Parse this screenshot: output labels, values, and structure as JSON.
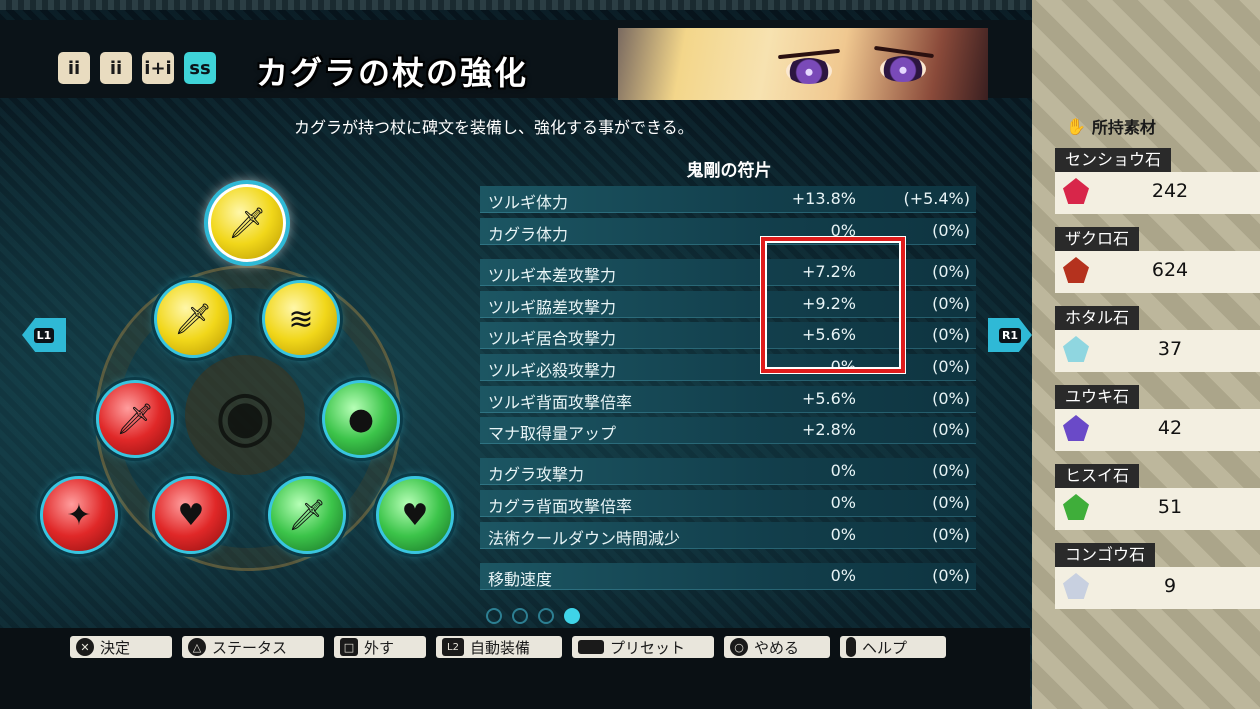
{
  "header": {
    "title": "カグラの杖の強化",
    "subtitle": "カグラが持つ杖に碑文を装備し、強化する事ができる。",
    "tabs": [
      {
        "icon": "ii",
        "active": false
      },
      {
        "icon": "ii",
        "active": false
      },
      {
        "icon": "i+i",
        "active": false
      },
      {
        "icon": "ss",
        "active": true
      }
    ]
  },
  "nav": {
    "left": "L1",
    "right": "R1"
  },
  "stats": {
    "heading": "鬼剛の符片",
    "rows": [
      {
        "label": "ツルギ体力",
        "value": "+13.8%",
        "total": "(+5.4%)"
      },
      {
        "label": "カグラ体力",
        "value": "0%",
        "total": "(0%)"
      },
      {
        "label": "ツルギ本差攻撃力",
        "value": "+7.2%",
        "total": "(0%)"
      },
      {
        "label": "ツルギ脇差攻撃力",
        "value": "+9.2%",
        "total": "(0%)"
      },
      {
        "label": "ツルギ居合攻撃力",
        "value": "+5.6%",
        "total": "(0%)"
      },
      {
        "label": "ツルギ必殺攻撃力",
        "value": "0%",
        "total": "(0%)"
      },
      {
        "label": "ツルギ背面攻撃倍率",
        "value": "+5.6%",
        "total": "(0%)"
      },
      {
        "label": "マナ取得量アップ",
        "value": "+2.8%",
        "total": "(0%)"
      },
      {
        "label": "カグラ攻撃力",
        "value": "0%",
        "total": "(0%)"
      },
      {
        "label": "カグラ背面攻撃倍率",
        "value": "0%",
        "total": "(0%)"
      },
      {
        "label": "法術クールダウン時間減少",
        "value": "0%",
        "total": "(0%)"
      },
      {
        "label": "移動速度",
        "value": "0%",
        "total": "(0%)"
      }
    ],
    "page_count": 4,
    "active_page": 4
  },
  "materials": {
    "heading": "所持素材",
    "items": [
      {
        "name": "センショウ石",
        "count": "242",
        "color": "#d8264a"
      },
      {
        "name": "ザクロ石",
        "count": "624",
        "color": "#b5321e"
      },
      {
        "name": "ホタル石",
        "count": "37",
        "color": "#8fd6e0"
      },
      {
        "name": "ユウキ石",
        "count": "42",
        "color": "#6a4ac8"
      },
      {
        "name": "ヒスイ石",
        "count": "51",
        "color": "#3fae3a"
      },
      {
        "name": "コンゴウ石",
        "count": "9",
        "color": "#c8d0e0"
      }
    ]
  },
  "controls": [
    {
      "glyph": "✕",
      "label": "決定"
    },
    {
      "glyph": "△",
      "label": "ステータス"
    },
    {
      "glyph": "□",
      "label": "外す"
    },
    {
      "glyph": "L2",
      "label": "自動装備"
    },
    {
      "glyph": "",
      "label": "プリセット"
    },
    {
      "glyph": "○",
      "label": "やめる"
    },
    {
      "glyph": "",
      "label": "ヘルプ"
    }
  ],
  "tree_nodes": [
    {
      "type": "sword",
      "color": "yellow"
    },
    {
      "type": "sword",
      "color": "yellow"
    },
    {
      "type": "slash",
      "color": "yellow"
    },
    {
      "type": "sword",
      "color": "red"
    },
    {
      "type": "gourd",
      "color": "green"
    },
    {
      "type": "wolf",
      "color": "red"
    },
    {
      "type": "heart",
      "color": "red"
    },
    {
      "type": "sword",
      "color": "green"
    },
    {
      "type": "heart",
      "color": "green"
    }
  ]
}
